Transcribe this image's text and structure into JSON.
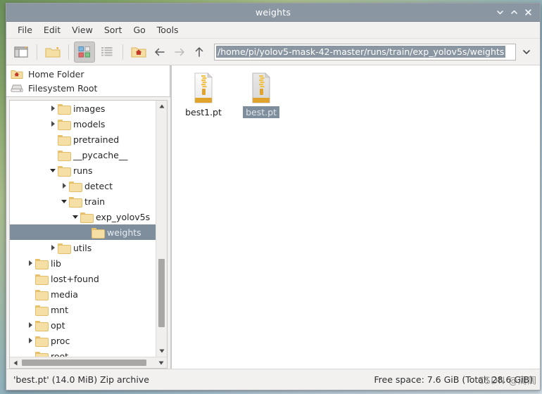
{
  "window": {
    "title": "weights",
    "buttons": {
      "minimize": "minimize-icon",
      "maximize": "maximize-icon",
      "close": "close-icon"
    }
  },
  "menubar": {
    "items": [
      {
        "label": "File"
      },
      {
        "label": "Edit"
      },
      {
        "label": "View"
      },
      {
        "label": "Sort"
      },
      {
        "label": "Go"
      },
      {
        "label": "Tools"
      }
    ]
  },
  "toolbar": {
    "new_tab_icon": "new-tab-icon",
    "new_folder_icon": "new-folder-icon",
    "icon_view_icon": "icon-view-icon",
    "detail_view_icon": "detail-view-icon",
    "home_icon": "home-folder-icon",
    "back_icon": "back-arrow-icon",
    "forward_icon": "forward-arrow-icon",
    "up_icon": "up-arrow-icon",
    "path_dropdown_icon": "chevron-down-icon"
  },
  "pathbar": {
    "value": "/home/pi/yolov5-mask-42-master/runs/train/exp_yolov5s/weights",
    "placeholder": "/home/pi"
  },
  "sidebar": {
    "places": [
      {
        "label": "Home Folder",
        "icon": "home-folder-icon"
      },
      {
        "label": "Filesystem Root",
        "icon": "drive-icon"
      }
    ],
    "tree": [
      {
        "label": "images",
        "indent": 3,
        "twisty": "collapsed",
        "selected": false
      },
      {
        "label": "models",
        "indent": 3,
        "twisty": "collapsed",
        "selected": false
      },
      {
        "label": "pretrained",
        "indent": 3,
        "twisty": "none",
        "selected": false
      },
      {
        "label": "__pycache__",
        "indent": 3,
        "twisty": "none",
        "selected": false
      },
      {
        "label": "runs",
        "indent": 3,
        "twisty": "expanded",
        "selected": false
      },
      {
        "label": "detect",
        "indent": 4,
        "twisty": "collapsed",
        "selected": false
      },
      {
        "label": "train",
        "indent": 4,
        "twisty": "expanded",
        "selected": false
      },
      {
        "label": "exp_yolov5s",
        "indent": 5,
        "twisty": "expanded",
        "selected": false
      },
      {
        "label": "weights",
        "indent": 6,
        "twisty": "none",
        "selected": true
      },
      {
        "label": "utils",
        "indent": 3,
        "twisty": "collapsed",
        "selected": false
      },
      {
        "label": "lib",
        "indent": 1,
        "twisty": "collapsed",
        "selected": false
      },
      {
        "label": "lost+found",
        "indent": 1,
        "twisty": "none",
        "selected": false
      },
      {
        "label": "media",
        "indent": 1,
        "twisty": "none",
        "selected": false
      },
      {
        "label": "mnt",
        "indent": 1,
        "twisty": "none",
        "selected": false
      },
      {
        "label": "opt",
        "indent": 1,
        "twisty": "collapsed",
        "selected": false
      },
      {
        "label": "proc",
        "indent": 1,
        "twisty": "collapsed",
        "selected": false
      },
      {
        "label": "root",
        "indent": 1,
        "twisty": "none",
        "selected": false
      }
    ]
  },
  "files": [
    {
      "name": "best1.pt",
      "icon": "zip-archive-icon",
      "selected": false
    },
    {
      "name": "best.pt",
      "icon": "zip-archive-icon",
      "selected": true
    }
  ],
  "statusbar": {
    "left": "'best.pt' (14.0 MiB) Zip archive",
    "right": "Free space: 7.6 GiB (Total: 28.6 GiB)",
    "watermark": "CSDN @周周"
  },
  "colors": {
    "titlebar": "#8a97a3",
    "selection": "#7f8e9c",
    "folder": "#f6dfa4",
    "chrome": "#f2f1f0"
  }
}
